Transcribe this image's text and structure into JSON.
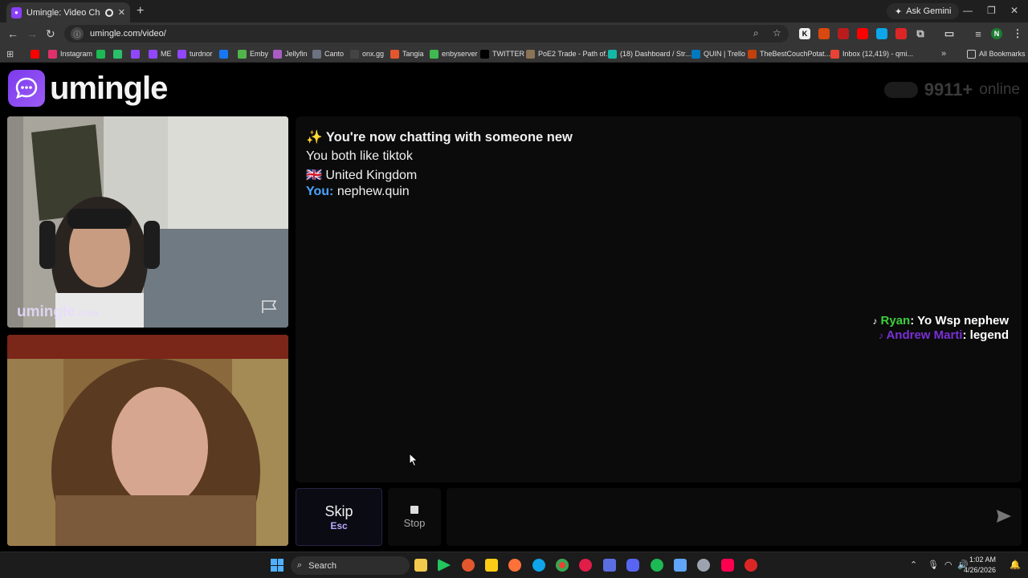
{
  "browser": {
    "tab_title": "Umingle: Video Chat with S",
    "url": "umingle.com/video/",
    "gemini_label": "Ask Gemini",
    "all_bookmarks": "All Bookmarks"
  },
  "bookmarks": [
    {
      "label": "",
      "color": "#ff0000"
    },
    {
      "label": "Instagram",
      "color": "#e1306c"
    },
    {
      "label": "",
      "color": "#1db954"
    },
    {
      "label": "",
      "color": "#2bbf6a"
    },
    {
      "label": "",
      "color": "#9146ff"
    },
    {
      "label": "ME",
      "color": "#9146ff"
    },
    {
      "label": "turdnor",
      "color": "#9146ff"
    },
    {
      "label": "",
      "color": "#1877f2"
    },
    {
      "label": "Emby",
      "color": "#52b54b"
    },
    {
      "label": "Jellyfin",
      "color": "#aa5cc3"
    },
    {
      "label": "Canto",
      "color": "#6b7280"
    },
    {
      "label": "onx.gg",
      "color": "#444444"
    },
    {
      "label": "Tangia",
      "color": "#e4572e"
    },
    {
      "label": "enbyserver",
      "color": "#3fb950"
    },
    {
      "label": "TWITTER",
      "color": "#000000"
    },
    {
      "label": "PoE2 Trade - Path of...",
      "color": "#8b7355"
    },
    {
      "label": "(18) Dashboard / Str...",
      "color": "#14b8a6"
    },
    {
      "label": "QUIN | Trello",
      "color": "#0079bf"
    },
    {
      "label": "TheBestCouchPotat...",
      "color": "#c2410c"
    },
    {
      "label": "Inbox (12,419) - qmi...",
      "color": "#ea4335"
    }
  ],
  "site": {
    "logo_text": "umingle",
    "online_count": "9911+",
    "online_label": "online",
    "watermark": "umingle",
    "watermark_suffix": ".com"
  },
  "chat": {
    "status": "✨ You're now chatting with someone new",
    "common_interest": "You both like tiktok",
    "country_flag": "🇬🇧",
    "country": "United Kingdom",
    "you_label": "You:",
    "you_message": "nephew.quin"
  },
  "tiktok_overlay": [
    {
      "user": "Ryan",
      "message": ": Yo Wsp nephew"
    },
    {
      "user": "Andrew Marti",
      "message": ": legend"
    }
  ],
  "controls": {
    "skip_label": "Skip",
    "skip_key": "Esc",
    "stop_label": "Stop",
    "message_placeholder": ""
  },
  "taskbar": {
    "search_label": "Search",
    "time": "1:02 AM",
    "date": "4/26/2026"
  },
  "colors": {
    "accent": "#7c3aed",
    "you_label": "#4aa3ff",
    "tt_user1": "#3ccf3c",
    "tt_user2": "#7a2fd6"
  }
}
